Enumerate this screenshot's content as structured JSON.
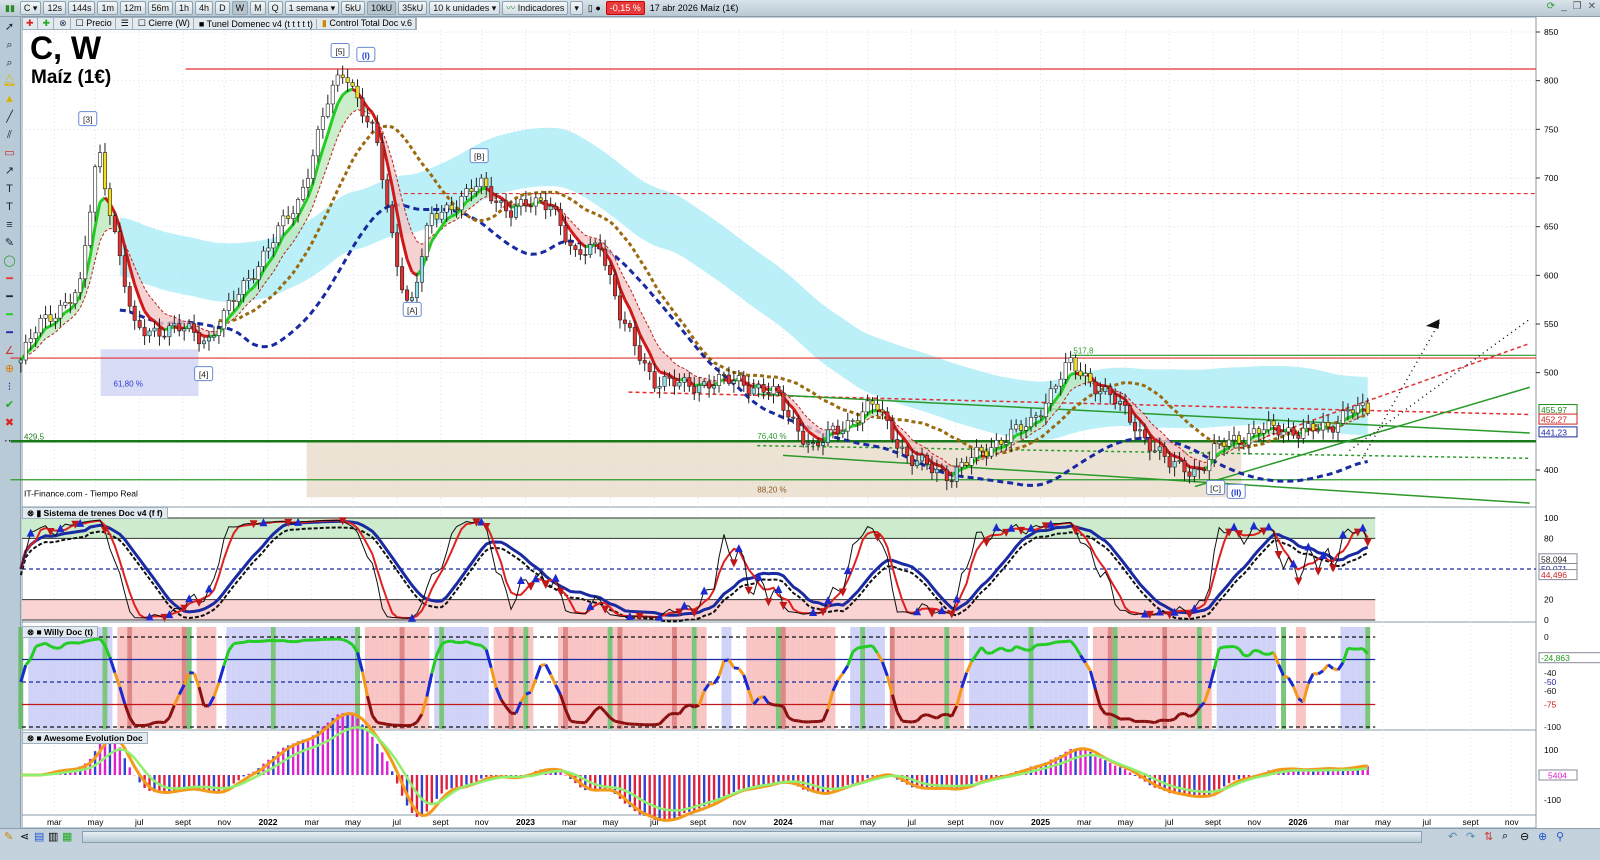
{
  "toolbar": {
    "symbol": "C",
    "timeframes": [
      "12s",
      "144s",
      "1m",
      "12m",
      "56m",
      "1h",
      "4h",
      "D",
      "W",
      "M",
      "Q"
    ],
    "active_timeframe": "W",
    "period": "1 semana",
    "units_buttons": [
      "5kU",
      "10kU",
      "35kU"
    ],
    "active_units": "10kU",
    "units_select": "10 k unidades",
    "indicators_label": "Indicadores",
    "change_badge": "-0,15 %",
    "date_info": "17 abr 2026 Maíz (1€)"
  },
  "legend": {
    "items": [
      "Precio",
      "Cierre (W)",
      "Tunel Domenec v4 (t t t t t)",
      "Control Total Doc v.6"
    ]
  },
  "chart": {
    "title": "C, W",
    "subtitle": "Maíz (1€)",
    "source": "IT-Finance.com - Tiempo Real",
    "price_ticks": [
      850,
      800,
      750,
      700,
      650,
      600,
      550,
      500,
      400
    ],
    "time_ticks": [
      {
        "label": "mar",
        "t": 2021.17
      },
      {
        "label": "may",
        "t": 2021.33
      },
      {
        "label": "jul",
        "t": 2021.5
      },
      {
        "label": "sept",
        "t": 2021.67
      },
      {
        "label": "nov",
        "t": 2021.83
      },
      {
        "label": "2022",
        "t": 2022.0
      },
      {
        "label": "mar",
        "t": 2022.17
      },
      {
        "label": "may",
        "t": 2022.33
      },
      {
        "label": "jul",
        "t": 2022.5
      },
      {
        "label": "sept",
        "t": 2022.67
      },
      {
        "label": "nov",
        "t": 2022.83
      },
      {
        "label": "2023",
        "t": 2023.0
      },
      {
        "label": "mar",
        "t": 2023.17
      },
      {
        "label": "may",
        "t": 2023.33
      },
      {
        "label": "jul",
        "t": 2023.5
      },
      {
        "label": "sept",
        "t": 2023.67
      },
      {
        "label": "nov",
        "t": 2023.83
      },
      {
        "label": "2024",
        "t": 2024.0
      },
      {
        "label": "mar",
        "t": 2024.17
      },
      {
        "label": "may",
        "t": 2024.33
      },
      {
        "label": "jul",
        "t": 2024.5
      },
      {
        "label": "sept",
        "t": 2024.67
      },
      {
        "label": "nov",
        "t": 2024.83
      },
      {
        "label": "2025",
        "t": 2025.0
      },
      {
        "label": "mar",
        "t": 2025.17
      },
      {
        "label": "may",
        "t": 2025.33
      },
      {
        "label": "jul",
        "t": 2025.5
      },
      {
        "label": "sept",
        "t": 2025.67
      },
      {
        "label": "nov",
        "t": 2025.83
      },
      {
        "label": "2026",
        "t": 2026.0
      },
      {
        "label": "mar",
        "t": 2026.17
      },
      {
        "label": "may",
        "t": 2026.33
      },
      {
        "label": "jul",
        "t": 2026.5
      },
      {
        "label": "sept",
        "t": 2026.67
      },
      {
        "label": "nov",
        "t": 2026.83
      }
    ],
    "wave_labels": [
      {
        "text": "[5]",
        "t": 2022.28,
        "p": 830
      },
      {
        "text": "(I)",
        "t": 2022.38,
        "p": 826
      },
      {
        "text": "[3]",
        "t": 2021.3,
        "p": 760
      },
      {
        "text": "[B]",
        "t": 2022.82,
        "p": 722
      },
      {
        "text": "[A]",
        "t": 2022.56,
        "p": 564
      },
      {
        "text": "[4]",
        "t": 2021.75,
        "p": 498
      },
      {
        "text": "[C]",
        "t": 2025.68,
        "p": 381
      },
      {
        "text": "(II)",
        "t": 2025.76,
        "p": 377
      }
    ],
    "levels": [
      {
        "p": 812,
        "color": "#e03030",
        "style": "solid",
        "from": 2021.68
      },
      {
        "p": 684,
        "color": "#e03030",
        "style": "dashed",
        "from": 2022.5
      },
      {
        "p": 515,
        "color": "#e03030",
        "style": "solid",
        "from": 2021.0
      },
      {
        "p": 517.8,
        "color": "#2a9a2a",
        "style": "solid",
        "from": 2025.12,
        "label": "517,8"
      },
      {
        "p": 429.5,
        "color": "#1a7a1a",
        "style": "thick",
        "from": 2021.0,
        "label": "429,5"
      },
      {
        "p": 390,
        "color": "#2a9a2a",
        "style": "solid",
        "from": 2021.0
      }
    ],
    "fib_labels": [
      {
        "text": "61,80 %",
        "t": 2021.4,
        "p": 486
      },
      {
        "text": "76,40 %",
        "t": 2023.9,
        "p": 432
      },
      {
        "text": "88,20 %",
        "t": 2023.9,
        "p": 377
      }
    ],
    "price_tags": [
      {
        "text": "455,97",
        "p": 459,
        "color": "#1a8a1a"
      },
      {
        "text": "452,27",
        "p": 452.3,
        "color": "#d02020"
      },
      {
        "text": "441,23",
        "p": 441.2,
        "color": "#1a2aa0"
      }
    ]
  },
  "chart_data": {
    "type": "line",
    "title": "C, W — Maíz (1€)",
    "xlabel": "",
    "ylabel": "Precio",
    "ylim": [
      380,
      850
    ],
    "series": [
      {
        "name": "Cierre (W) approx.",
        "x": [
          2021.04,
          2021.11,
          2021.27,
          2021.34,
          2021.41,
          2021.48,
          2021.68,
          2021.77,
          2021.97,
          2022.12,
          2022.24,
          2022.3,
          2022.42,
          2022.49,
          2022.55,
          2022.63,
          2022.82,
          2022.94,
          2023.1,
          2023.19,
          2023.29,
          2023.37,
          2023.5,
          2023.6,
          2023.83,
          2023.97,
          2024.12,
          2024.2,
          2024.36,
          2024.49,
          2024.65,
          2024.84,
          2024.96,
          2025.08,
          2025.11,
          2025.27,
          2025.35,
          2025.5,
          2025.62,
          2025.7,
          2025.85,
          2026.01,
          2026.12,
          2026.2,
          2026.28
        ],
        "values": [
          513,
          549,
          585,
          734,
          636,
          544,
          544,
          534,
          616,
          677,
          785,
          811,
          739,
          626,
          564,
          657,
          693,
          667,
          677,
          616,
          636,
          554,
          492,
          487,
          492,
          477,
          420,
          441,
          467,
          410,
          395,
          431,
          446,
          498,
          508,
          477,
          451,
          405,
          400,
          426,
          441,
          441,
          441,
          467,
          456
        ]
      }
    ]
  },
  "panels": {
    "trenes": {
      "title": "Sistema de trenes Doc v4 (f f)",
      "ticks": [
        100,
        80,
        20,
        0
      ],
      "tags": [
        "58,094",
        "50,071",
        "44,496"
      ]
    },
    "willy": {
      "title": "Willy Doc (t)",
      "ticks": [
        0,
        -25,
        -40,
        -50,
        -60,
        -75,
        -100
      ],
      "tags": [
        "-24,863"
      ]
    },
    "awesome": {
      "title": "Awesome Evolution Doc",
      "ticks": [
        100,
        -100
      ],
      "tags": [
        "5404"
      ]
    }
  }
}
